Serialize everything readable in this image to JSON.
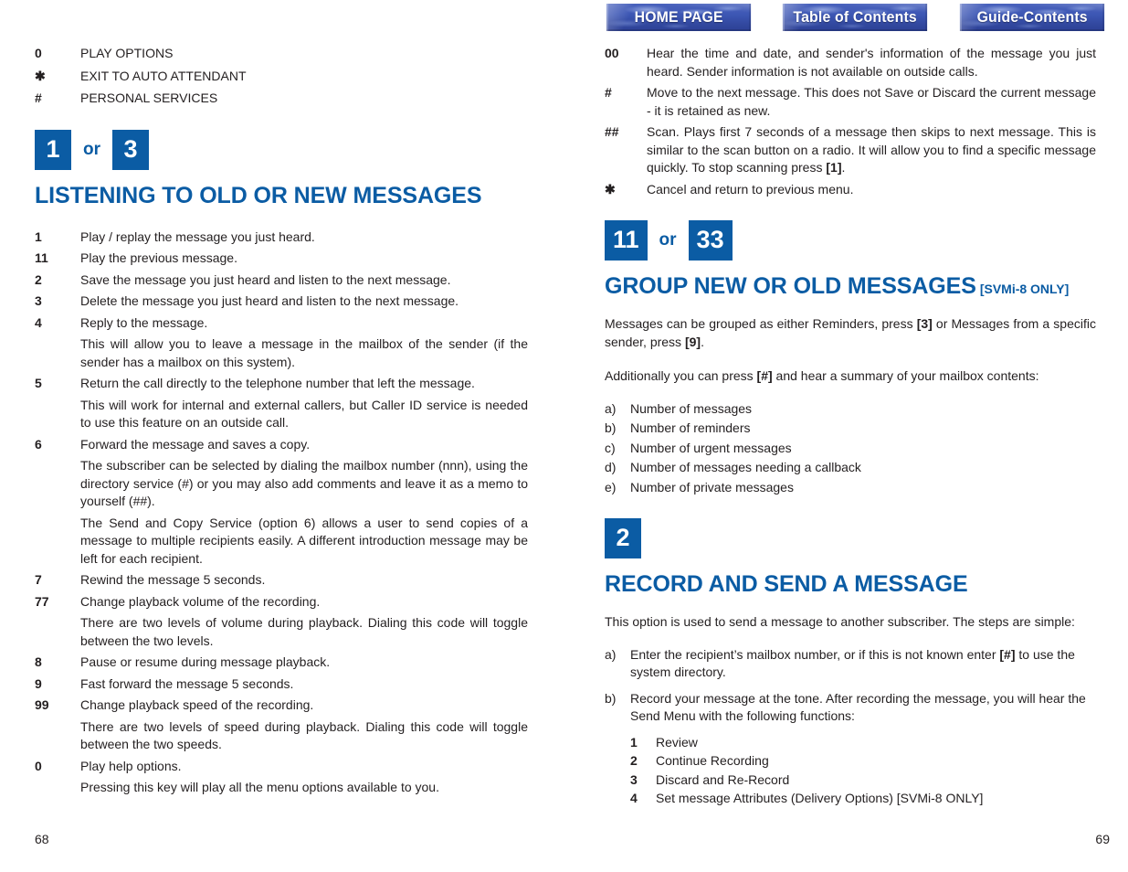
{
  "nav": {
    "buttons": [
      {
        "label": "HOME PAGE",
        "name": "home-page"
      },
      {
        "label": "Table of Contents",
        "name": "table-of-contents"
      },
      {
        "label": "Guide-Contents",
        "name": "guide-contents"
      }
    ],
    "accent_color": "#3d57b4"
  },
  "theme": {
    "accent_blue": "#0b5ca4",
    "text_color": "#231f20"
  },
  "left_page": {
    "page_number": "68",
    "top_caps_list": [
      {
        "key": "0",
        "text": "PLAY OPTIONS"
      },
      {
        "key": "✱",
        "text": "EXIT TO AUTO ATTENDANT"
      },
      {
        "key": "#",
        "text": "PERSONAL SERVICES"
      }
    ],
    "section": {
      "badges": [
        "1",
        "3"
      ],
      "or_label": "or",
      "title": "LISTENING TO OLD OR NEW MESSAGES"
    },
    "items": [
      {
        "key": "1",
        "text": "Play / replay the message you just heard.",
        "notes": []
      },
      {
        "key": "11",
        "text": "Play the previous message.",
        "notes": []
      },
      {
        "key": "2",
        "text": "Save the message you just heard and listen to the next message.",
        "notes": []
      },
      {
        "key": "3",
        "text": "Delete the message you just heard and listen to the next message.",
        "notes": []
      },
      {
        "key": "4",
        "text": "Reply to the message.",
        "notes": [
          "This will allow you to leave a message in the mailbox of the sender (if the sender has a mailbox on this system)."
        ]
      },
      {
        "key": "5",
        "text": "Return the call directly to the telephone number that left the message.",
        "notes": [
          "This will work for internal and external callers, but Caller ID service is needed to use this feature on an outside call."
        ]
      },
      {
        "key": "6",
        "text": "Forward the message and saves a copy.",
        "notes": [
          "The subscriber can be selected by dialing the mailbox number (nnn), using the directory service (#) or you may also add comments and leave it as a memo to yourself (##).",
          "The Send and Copy Service (option 6) allows a user to send copies of a message to multiple recipients easily. A different introduction message may be left for each recipient."
        ]
      },
      {
        "key": "7",
        "text": "Rewind the message 5 seconds.",
        "notes": []
      },
      {
        "key": "77",
        "text": "Change playback volume of the recording.",
        "notes": [
          "There are two levels of volume during playback. Dialing this code will toggle between the two levels."
        ]
      },
      {
        "key": "8",
        "text": "Pause or resume during message playback.",
        "notes": []
      },
      {
        "key": "9",
        "text": "Fast forward the message 5 seconds.",
        "notes": []
      },
      {
        "key": "99",
        "text": "Change playback speed of the recording.",
        "notes": [
          "There are two levels of speed during playback. Dialing this code will toggle between the two speeds."
        ]
      },
      {
        "key": "0",
        "text": "Play help options.",
        "notes": [
          "Pressing this key will play all the menu options available to you."
        ]
      }
    ]
  },
  "right_page": {
    "page_number": "69",
    "items": [
      {
        "key": "00",
        "text": "Hear the time and date, and sender's information of the message you just heard. Sender information is not available on outside calls."
      },
      {
        "key": "#",
        "text": "Move to the next message. This does not Save or Discard the current message - it is retained as new."
      },
      {
        "key": "##",
        "text_html": "Scan. Plays first 7 seconds of a message then skips to next message. This is similar to the scan button on a radio. It will allow you to find a specific message quickly. To stop scanning press <b>[1]</b>."
      },
      {
        "key": "✱",
        "text": "Cancel and return to previous menu."
      }
    ],
    "section_group": {
      "badges": [
        "11",
        "33"
      ],
      "or_label": "or",
      "title": "GROUP NEW OR OLD MESSAGES",
      "title_suffix": "[SVMi-8 ONLY]",
      "para1_html": "Messages can be grouped as either Reminders, press <b>[3]</b> or Messages from a specific sender, press <b>[9]</b>.",
      "para2_html": "Additionally you can press <b>[#]</b> and hear a summary of your mailbox contents:",
      "list": [
        {
          "mark": "a)",
          "text": "Number of messages"
        },
        {
          "mark": "b)",
          "text": "Number of reminders"
        },
        {
          "mark": "c)",
          "text": "Number of urgent messages"
        },
        {
          "mark": "d)",
          "text": "Number of messages needing a callback"
        },
        {
          "mark": "e)",
          "text": "Number of private messages"
        }
      ]
    },
    "section_record": {
      "badges": [
        "2"
      ],
      "title": "RECORD AND SEND A MESSAGE",
      "intro": "This option is used to send a message to another subscriber. The steps are simple:",
      "steps": [
        {
          "mark": "a)",
          "text_html": "Enter the recipient’s mailbox number, or if this is not known enter <b>[#]</b> to use the system directory."
        },
        {
          "mark": "b)",
          "text_html": "Record your message at the tone. After recording the message, you will hear the Send Menu with the following functions:"
        }
      ],
      "send_menu": [
        {
          "key": "1",
          "text": "Review"
        },
        {
          "key": "2",
          "text": "Continue Recording"
        },
        {
          "key": "3",
          "text": "Discard and Re-Record"
        },
        {
          "key": "4",
          "text": "Set message Attributes (Delivery Options) [SVMi-8 ONLY]"
        }
      ]
    }
  }
}
